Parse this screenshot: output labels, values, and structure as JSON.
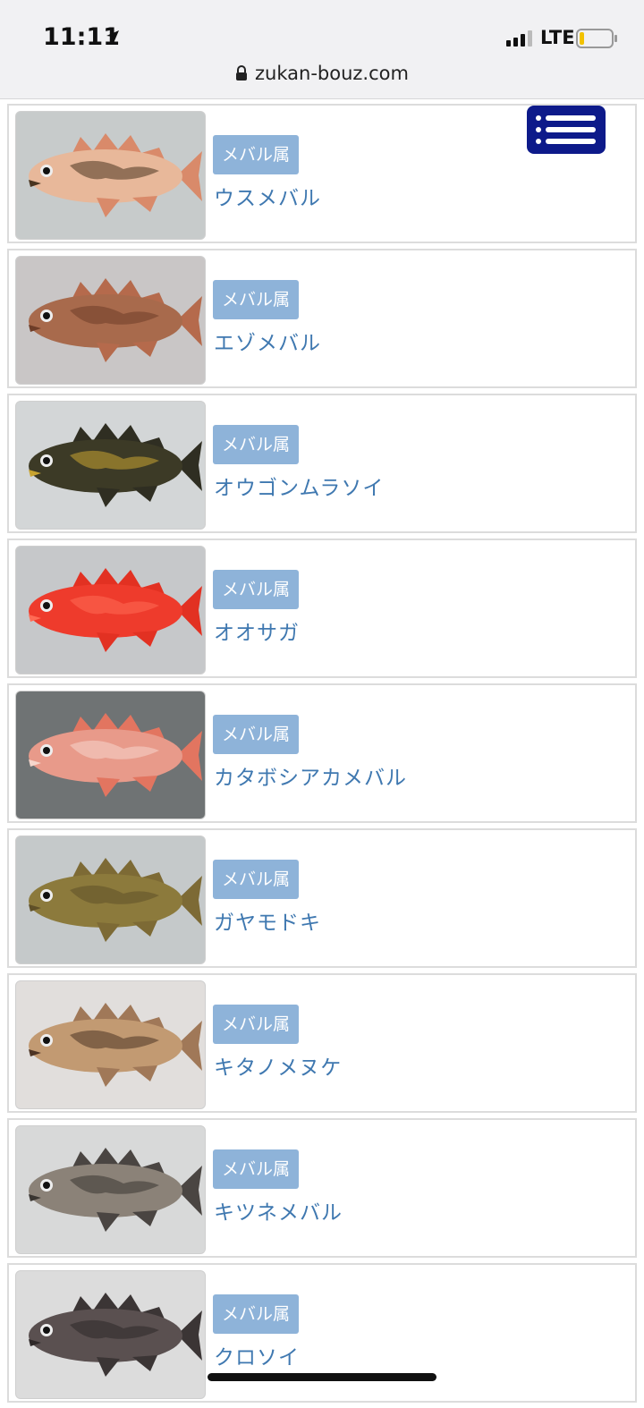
{
  "status": {
    "time": "11:11",
    "network": "LTE"
  },
  "browser": {
    "url": "zukan-bouz.com"
  },
  "items": [
    {
      "genus": "メバル属",
      "name": "ウスメバル",
      "colors": {
        "bg": "#c7cbcb",
        "body": "#e8b89a",
        "dark": "#4a3520",
        "fin": "#d98a6a"
      }
    },
    {
      "genus": "メバル属",
      "name": "エゾメバル",
      "colors": {
        "bg": "#c9c6c6",
        "body": "#a86a4c",
        "dark": "#6e3d28",
        "fin": "#b56a4c"
      }
    },
    {
      "genus": "メバル属",
      "name": "オウゴンムラソイ",
      "colors": {
        "bg": "#d3d6d7",
        "body": "#3c3a26",
        "dark": "#c8a431",
        "fin": "#2f2e22"
      }
    },
    {
      "genus": "メバル属",
      "name": "オオサガ",
      "colors": {
        "bg": "#c6c8ca",
        "body": "#ee3b2c",
        "dark": "#ff6b55",
        "fin": "#e23122"
      }
    },
    {
      "genus": "メバル属",
      "name": "カタボシアカメバル",
      "colors": {
        "bg": "#6f7374",
        "body": "#e89a8a",
        "dark": "#f6d6cc",
        "fin": "#e27560"
      }
    },
    {
      "genus": "メバル属",
      "name": "ガヤモドキ",
      "colors": {
        "bg": "#c5c9ca",
        "body": "#8c7a3c",
        "dark": "#5f5028",
        "fin": "#7d6a35"
      }
    },
    {
      "genus": "メバル属",
      "name": "キタノメヌケ",
      "colors": {
        "bg": "#e1dedc",
        "body": "#c29a72",
        "dark": "#4d3424",
        "fin": "#a07858"
      }
    },
    {
      "genus": "メバル属",
      "name": "キツネメバル",
      "colors": {
        "bg": "#d8d9d9",
        "body": "#8b8278",
        "dark": "#3a3632",
        "fin": "#4a4542"
      }
    },
    {
      "genus": "メバル属",
      "name": "クロソイ",
      "colors": {
        "bg": "#dcdcdc",
        "body": "#5a5050",
        "dark": "#2e2828",
        "fin": "#3b3535"
      }
    }
  ]
}
